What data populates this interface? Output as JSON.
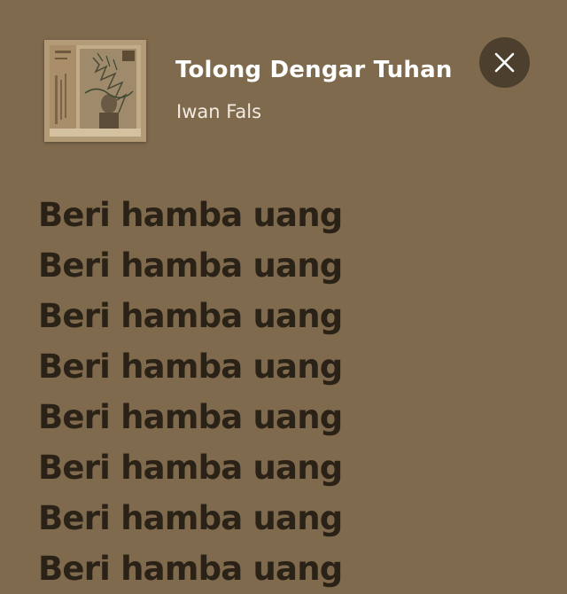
{
  "track": {
    "title": "Tolong Dengar Tuhan",
    "artist": "Iwan Fals"
  },
  "icons": {
    "close": "close-icon",
    "album_art": "album-cover-image"
  },
  "colors": {
    "background": "#7f6a4d",
    "title": "#ffffff",
    "artist": "#f1ebe1",
    "lyrics": "#2b2217",
    "close_button_bg": "#4d3f2e"
  },
  "lyrics": [
    "Beri hamba uang",
    "Beri hamba uang",
    "Beri hamba uang",
    "Beri hamba uang",
    "Beri hamba uang",
    "Beri hamba uang",
    "Beri hamba uang",
    "Beri hamba uang"
  ]
}
